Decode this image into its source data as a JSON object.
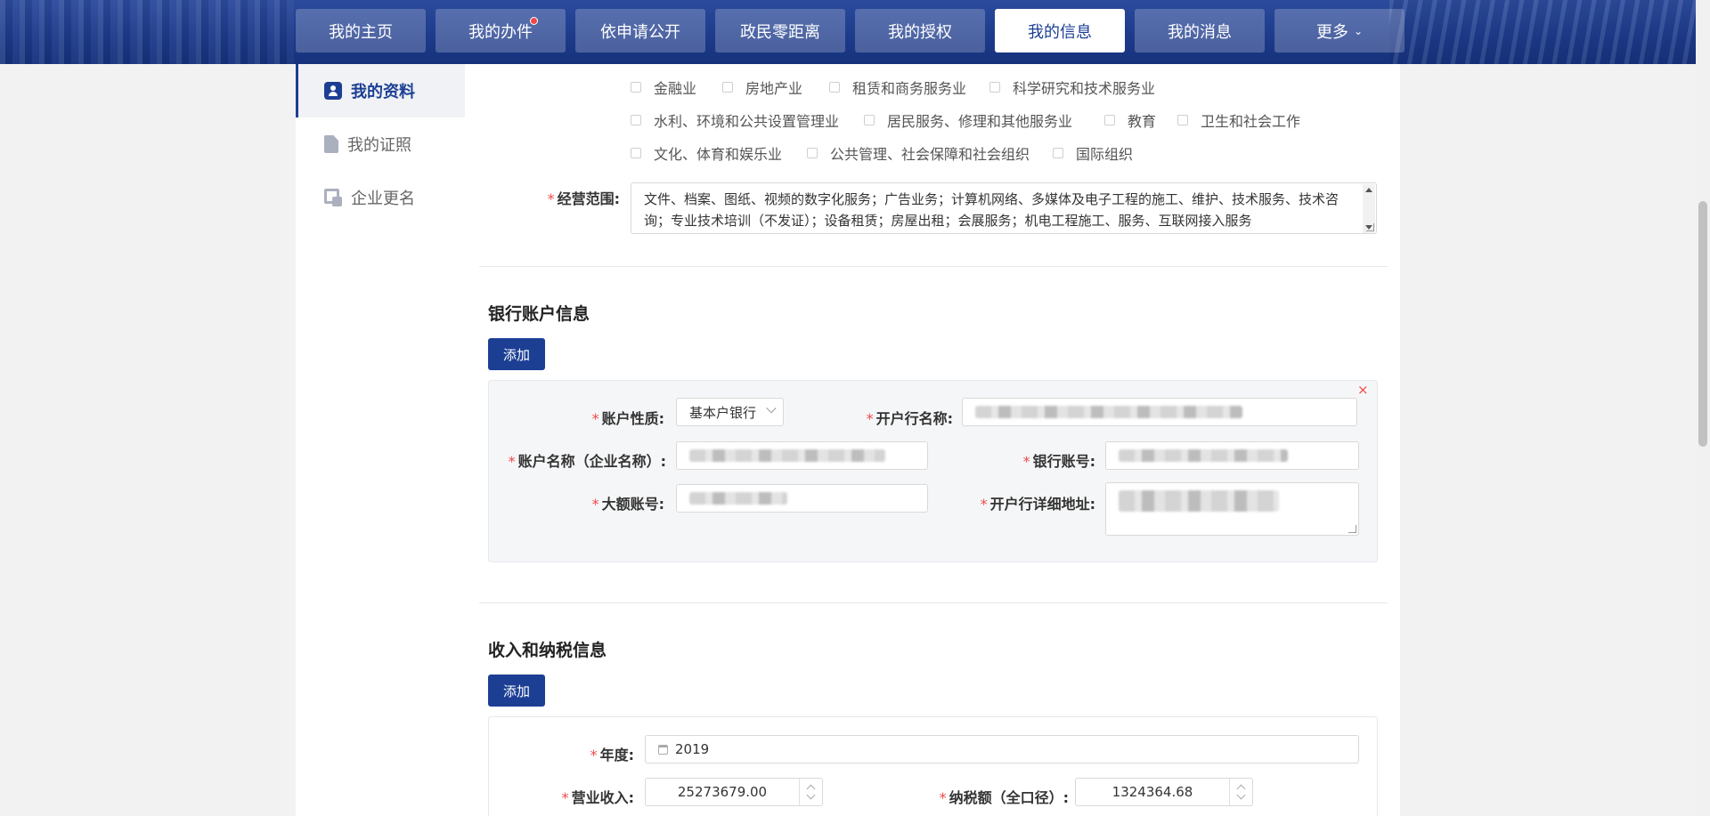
{
  "nav": {
    "tabs": [
      {
        "label": "我的主页"
      },
      {
        "label": "我的办件"
      },
      {
        "label": "依申请公开"
      },
      {
        "label": "政民零距离"
      },
      {
        "label": "我的授权"
      },
      {
        "label": "我的信息"
      },
      {
        "label": "我的消息"
      },
      {
        "label": "更多"
      }
    ],
    "active_tab": "我的信息",
    "more_caret": "⌄",
    "badge_on_tab": "我的办件",
    "accent_color": "#1c3f94"
  },
  "sidebar": {
    "items": [
      {
        "label": "我的资料",
        "icon": "user-card-icon",
        "active": true
      },
      {
        "label": "我的证照",
        "icon": "document-icon",
        "active": false
      },
      {
        "label": "企业更名",
        "icon": "rename-icon",
        "active": false
      }
    ]
  },
  "industries": {
    "row1": [
      "金融业",
      "房地产业",
      "租赁和商务服务业",
      "科学研究和技术服务业"
    ],
    "row2": [
      "水利、环境和公共设置管理业",
      "居民服务、修理和其他服务业",
      "教育",
      "卫生和社会工作"
    ],
    "row3": [
      "文化、体育和娱乐业",
      "公共管理、社会保障和社会组织",
      "国际组织"
    ]
  },
  "business_scope": {
    "label": "经营范围:",
    "value": "文件、档案、图纸、视频的数字化服务；广告业务；计算机网络、多媒体及电子工程的施工、维护、技术服务、技术咨询；专业技术培训（不发证）；设备租赁；房屋出租；会展服务；机电工程施工、服务、互联网接入服务"
  },
  "bank": {
    "section_title": "银行账户信息",
    "add_label": "添加",
    "close_label": "×",
    "fields": {
      "account_type_label": "账户性质:",
      "account_type_value": "基本户银行",
      "bank_name_label": "开户行名称:",
      "account_name_label": "账户名称（企业名称）:",
      "account_no_label": "银行账号:",
      "large_account_label": "大额账号:",
      "bank_address_label": "开户行详细地址:"
    }
  },
  "tax": {
    "section_title": "收入和纳税信息",
    "add_label": "添加",
    "year_label": "年度:",
    "year_value": "2019",
    "revenue_label": "营业收入:",
    "revenue_value": "25273679.00",
    "tax_label": "纳税额（全口径）:",
    "tax_value": "1324364.68"
  }
}
